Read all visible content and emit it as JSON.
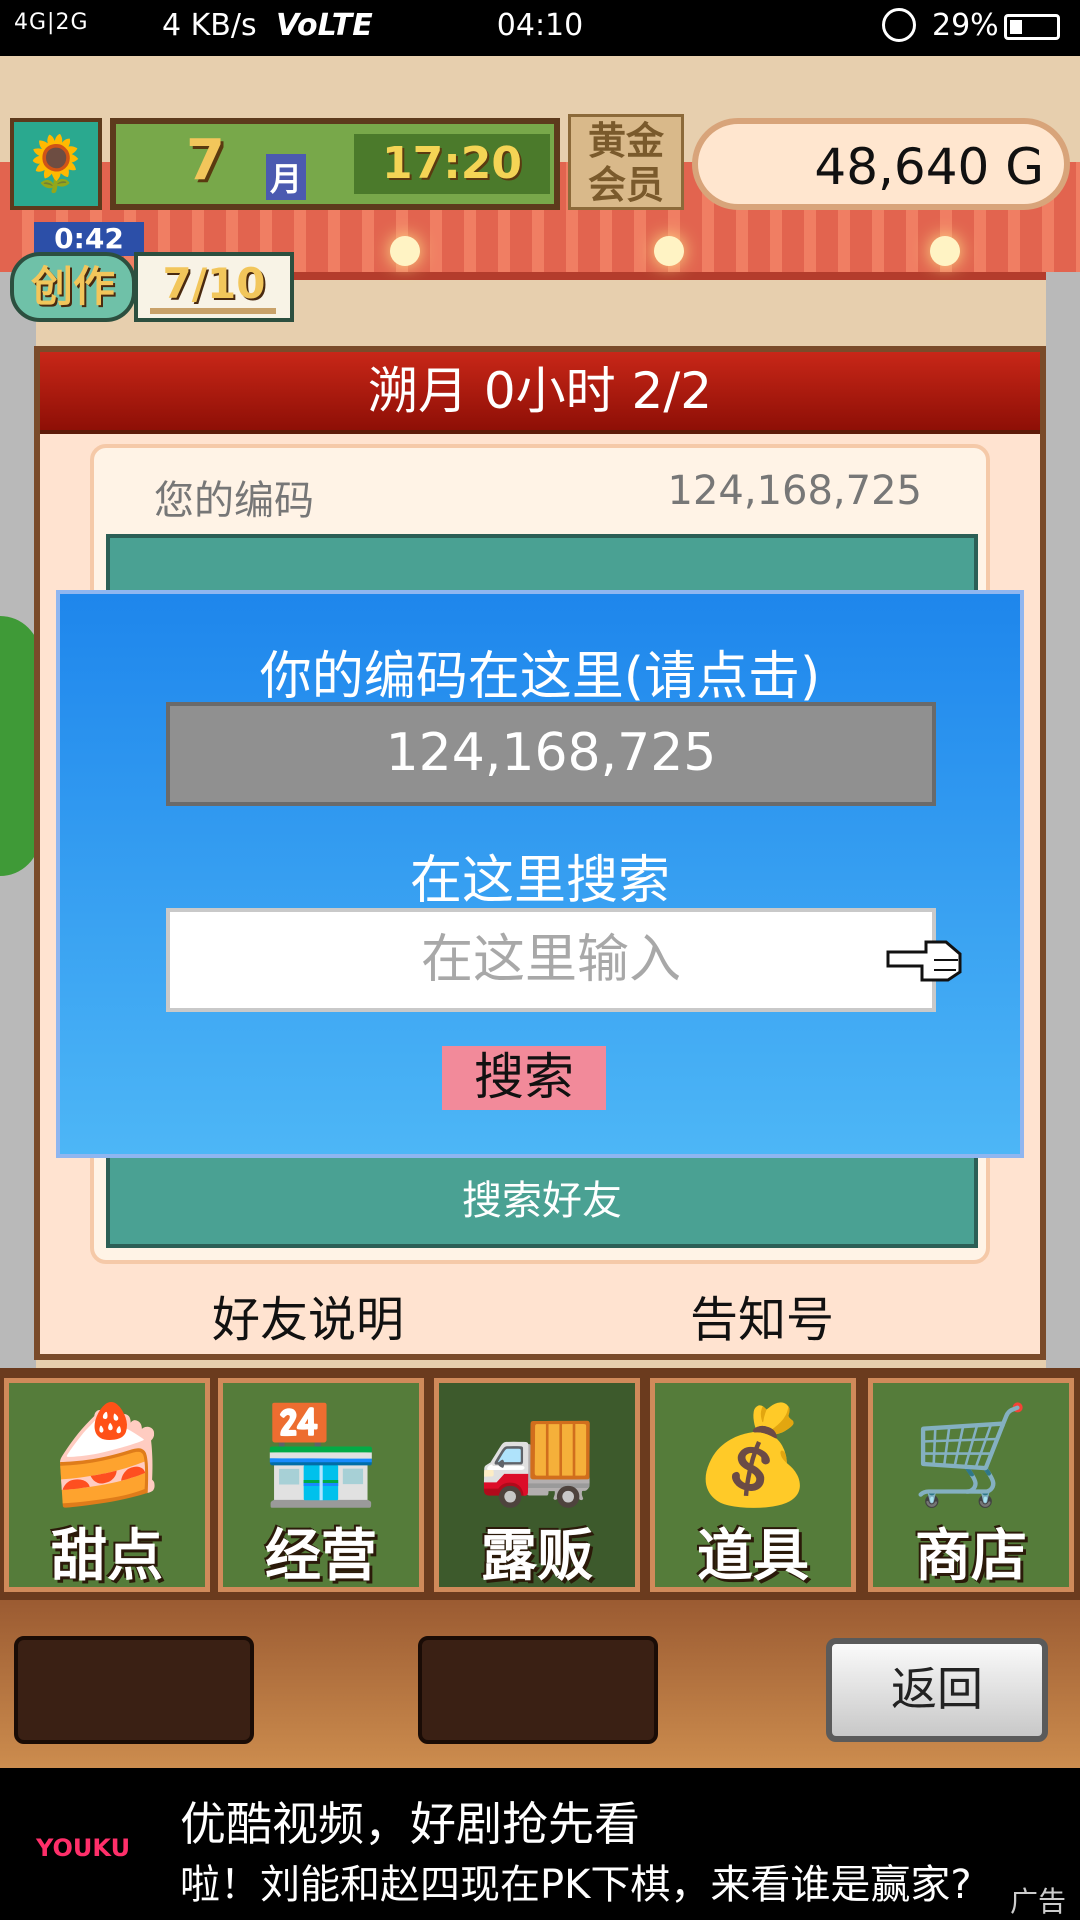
{
  "status_bar": {
    "signal": "4G|2G",
    "speed": "4 KB/s",
    "volte": "VoLTE",
    "time": "04:10",
    "battery": "29%"
  },
  "hud": {
    "month": "7",
    "month_unit": "月",
    "time": "17:20",
    "member_label": "黄金会员",
    "gold": "48,640 G"
  },
  "create_badge": {
    "timer": "0:42",
    "label": "创作",
    "count": "7/10"
  },
  "panel": {
    "header": "溯月  0小时 2/2",
    "code_label": "您的编码",
    "code_value": "124,168,725",
    "search_friends": "搜索好友",
    "footer_left": "好友说明",
    "footer_right": "告知号"
  },
  "dialog": {
    "title": "你的编码在这里(请点击)",
    "code": "124,168,725",
    "search_title": "在这里搜索",
    "input_placeholder": "在这里输入",
    "search_button": "搜索"
  },
  "menu": {
    "items": [
      {
        "label": "甜点",
        "icon": "cake-icon"
      },
      {
        "label": "经营",
        "icon": "shop-icon"
      },
      {
        "label": "露贩",
        "icon": "food-truck-icon"
      },
      {
        "label": "道具",
        "icon": "items-bag-icon"
      },
      {
        "label": "商店",
        "icon": "shopping-cart-icon"
      }
    ]
  },
  "back_button": "返回",
  "ad": {
    "logo": "YOUKU",
    "headline": "优酷视频，好剧抢先看",
    "subline": "啦！刘能和赵四现在PK下棋，来看谁是赢家?",
    "tag": "广告"
  },
  "colors": {
    "dialog_blue": "#1e86ec",
    "header_red": "#c82718",
    "search_button_pink": "#f28a9a"
  }
}
